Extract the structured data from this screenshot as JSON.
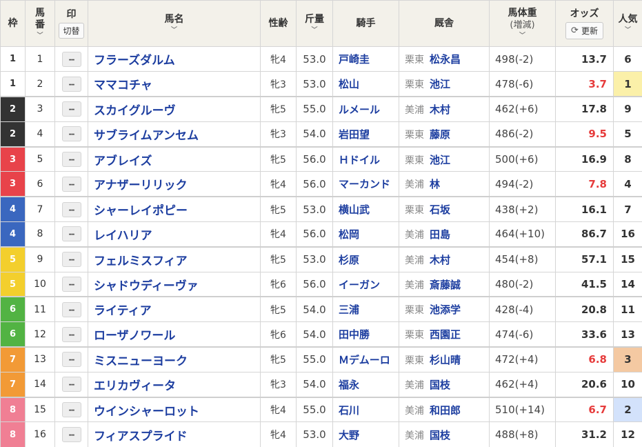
{
  "header": {
    "waku": "枠",
    "umaban": "馬番",
    "mark": "印",
    "mark_switch": "切替",
    "horse_name": "馬名",
    "sex_age": "性齢",
    "weight": "斤量",
    "jockey": "騎手",
    "stable": "厩舎",
    "body_weight": "馬体重",
    "body_weight_sub": "(増減)",
    "odds": "オッズ",
    "refresh": "更新",
    "popularity": "人気",
    "sort_icon": "chevron-down-icon",
    "refresh_icon": "refresh-icon"
  },
  "colors": {
    "waku": {
      "1": {
        "bg": "#ffffff",
        "fg": "#333333"
      },
      "2": {
        "bg": "#333333",
        "fg": "#ffffff"
      },
      "3": {
        "bg": "#e8434a",
        "fg": "#ffffff"
      },
      "4": {
        "bg": "#3a67bf",
        "fg": "#ffffff"
      },
      "5": {
        "bg": "#f3cf2d",
        "fg": "#ffffff"
      },
      "6": {
        "bg": "#52b343",
        "fg": "#ffffff"
      },
      "7": {
        "bg": "#f29a36",
        "fg": "#ffffff"
      },
      "8": {
        "bg": "#f07f94",
        "fg": "#ffffff"
      }
    },
    "odds_low": "#e63b3b",
    "odds_normal": "#333333",
    "pop1_bg": "#fbf0a9",
    "pop2_bg": "#d3e2fb",
    "pop3_bg": "#f4c9a2",
    "link": "#1d3ea0"
  },
  "rows": [
    {
      "waku": "1",
      "umaban": "1",
      "mark": "--",
      "name": "フラーズダルム",
      "sex_age": "牝4",
      "weight": "53.0",
      "jockey": "戸崎圭",
      "region": "栗東",
      "trainer": "松永昌",
      "body_weight": "498(-2)",
      "odds": "13.7",
      "odds_hot": false,
      "pop": "6"
    },
    {
      "waku": "1",
      "umaban": "2",
      "mark": "--",
      "name": "ママコチャ",
      "sex_age": "牝3",
      "weight": "53.0",
      "jockey": "松山",
      "region": "栗東",
      "trainer": "池江",
      "body_weight": "478(-6)",
      "odds": "3.7",
      "odds_hot": true,
      "pop": "1"
    },
    {
      "waku": "2",
      "umaban": "3",
      "mark": "--",
      "name": "スカイグルーヴ",
      "sex_age": "牝5",
      "weight": "55.0",
      "jockey": "ルメール",
      "region": "美浦",
      "trainer": "木村",
      "body_weight": "462(+6)",
      "odds": "17.8",
      "odds_hot": false,
      "pop": "9"
    },
    {
      "waku": "2",
      "umaban": "4",
      "mark": "--",
      "name": "サブライムアンセム",
      "sex_age": "牝3",
      "weight": "54.0",
      "jockey": "岩田望",
      "region": "栗東",
      "trainer": "藤原",
      "body_weight": "486(-2)",
      "odds": "9.5",
      "odds_hot": true,
      "pop": "5"
    },
    {
      "waku": "3",
      "umaban": "5",
      "mark": "--",
      "name": "アブレイズ",
      "sex_age": "牝5",
      "weight": "56.0",
      "jockey": "Ｈドイル",
      "region": "栗東",
      "trainer": "池江",
      "body_weight": "500(+6)",
      "odds": "16.9",
      "odds_hot": false,
      "pop": "8"
    },
    {
      "waku": "3",
      "umaban": "6",
      "mark": "--",
      "name": "アナザーリリック",
      "sex_age": "牝4",
      "weight": "56.0",
      "jockey": "マーカンド",
      "region": "美浦",
      "trainer": "林",
      "body_weight": "494(-2)",
      "odds": "7.8",
      "odds_hot": true,
      "pop": "4"
    },
    {
      "waku": "4",
      "umaban": "7",
      "mark": "--",
      "name": "シャーレイポピー",
      "sex_age": "牝5",
      "weight": "53.0",
      "jockey": "横山武",
      "region": "栗東",
      "trainer": "石坂",
      "body_weight": "438(+2)",
      "odds": "16.1",
      "odds_hot": false,
      "pop": "7"
    },
    {
      "waku": "4",
      "umaban": "8",
      "mark": "--",
      "name": "レイハリア",
      "sex_age": "牝4",
      "weight": "56.0",
      "jockey": "松岡",
      "region": "美浦",
      "trainer": "田島",
      "body_weight": "464(+10)",
      "odds": "86.7",
      "odds_hot": false,
      "pop": "16"
    },
    {
      "waku": "5",
      "umaban": "9",
      "mark": "--",
      "name": "フェルミスフィア",
      "sex_age": "牝5",
      "weight": "53.0",
      "jockey": "杉原",
      "region": "美浦",
      "trainer": "木村",
      "body_weight": "454(+8)",
      "odds": "57.1",
      "odds_hot": false,
      "pop": "15"
    },
    {
      "waku": "5",
      "umaban": "10",
      "mark": "--",
      "name": "シャドウディーヴァ",
      "sex_age": "牝6",
      "weight": "56.0",
      "jockey": "イーガン",
      "region": "美浦",
      "trainer": "斎藤誠",
      "body_weight": "480(-2)",
      "odds": "41.5",
      "odds_hot": false,
      "pop": "14"
    },
    {
      "waku": "6",
      "umaban": "11",
      "mark": "--",
      "name": "ライティア",
      "sex_age": "牝5",
      "weight": "54.0",
      "jockey": "三浦",
      "region": "栗東",
      "trainer": "池添学",
      "body_weight": "428(-4)",
      "odds": "20.8",
      "odds_hot": false,
      "pop": "11"
    },
    {
      "waku": "6",
      "umaban": "12",
      "mark": "--",
      "name": "ローザノワール",
      "sex_age": "牝6",
      "weight": "54.0",
      "jockey": "田中勝",
      "region": "栗東",
      "trainer": "西園正",
      "body_weight": "474(-6)",
      "odds": "33.6",
      "odds_hot": false,
      "pop": "13"
    },
    {
      "waku": "7",
      "umaban": "13",
      "mark": "--",
      "name": "ミスニューヨーク",
      "sex_age": "牝5",
      "weight": "55.0",
      "jockey": "Ｍデムーロ",
      "region": "栗東",
      "trainer": "杉山晴",
      "body_weight": "472(+4)",
      "odds": "6.8",
      "odds_hot": true,
      "pop": "3"
    },
    {
      "waku": "7",
      "umaban": "14",
      "mark": "--",
      "name": "エリカヴィータ",
      "sex_age": "牝3",
      "weight": "54.0",
      "jockey": "福永",
      "region": "美浦",
      "trainer": "国枝",
      "body_weight": "462(+4)",
      "odds": "20.6",
      "odds_hot": false,
      "pop": "10"
    },
    {
      "waku": "8",
      "umaban": "15",
      "mark": "--",
      "name": "ウインシャーロット",
      "sex_age": "牝4",
      "weight": "55.0",
      "jockey": "石川",
      "region": "美浦",
      "trainer": "和田郎",
      "body_weight": "510(+14)",
      "odds": "6.7",
      "odds_hot": true,
      "pop": "2"
    },
    {
      "waku": "8",
      "umaban": "16",
      "mark": "--",
      "name": "フィアスプライド",
      "sex_age": "牝4",
      "weight": "53.0",
      "jockey": "大野",
      "region": "美浦",
      "trainer": "国枝",
      "body_weight": "488(+8)",
      "odds": "31.2",
      "odds_hot": false,
      "pop": "12"
    }
  ]
}
